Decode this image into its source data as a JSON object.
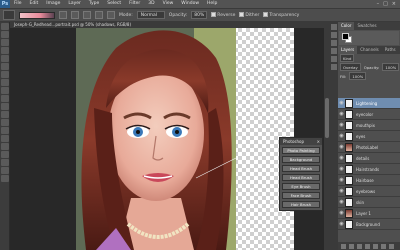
{
  "menubar": {
    "logo": "Ps",
    "items": [
      "File",
      "Edit",
      "Image",
      "Layer",
      "Type",
      "Select",
      "Filter",
      "3D",
      "View",
      "Window",
      "Help"
    ],
    "controls": [
      "–",
      "□",
      "×"
    ]
  },
  "options": {
    "mode_label": "Mode:",
    "mode_value": "Normal",
    "opacity_label": "Opacity:",
    "opacity_value": "80%",
    "reverse": "Reverse",
    "dither": "Dither",
    "transparency": "Transparency"
  },
  "document": {
    "tab_title": "Joseph-G_Redhead...portrait.psd @ 50% (shadows, RGB/8)"
  },
  "actions_panel": {
    "title": "Photoshop",
    "close": "×",
    "buttons": [
      "Photo Painting",
      "Background",
      "Head Brush",
      "Head Brush",
      "Eye Brush",
      "Face Brush",
      "Hair Brush"
    ]
  },
  "right_panel": {
    "top_tabs": [
      "Color",
      "Swatches"
    ],
    "mid_tabs": [
      "Layers",
      "Channels",
      "Paths"
    ],
    "kind_label": "Kind",
    "blend_mode": "Overlay",
    "opacity_label": "Opacity:",
    "opacity_value": "100%",
    "fill_label": "Fill:",
    "fill_value": "100%",
    "layers": [
      {
        "name": "Lightening",
        "selected": true,
        "thumb": "white"
      },
      {
        "name": "eyecolor",
        "selected": false,
        "thumb": "white"
      },
      {
        "name": "mouthpix",
        "selected": false,
        "thumb": "white"
      },
      {
        "name": "eyes",
        "selected": false,
        "thumb": "white"
      },
      {
        "name": "PhotoLabel",
        "selected": false,
        "thumb": "photo"
      },
      {
        "name": "details",
        "selected": false,
        "thumb": "white"
      },
      {
        "name": "Hairstrands",
        "selected": false,
        "thumb": "white"
      },
      {
        "name": "Hairbase",
        "selected": false,
        "thumb": "white"
      },
      {
        "name": "eyebrows",
        "selected": false,
        "thumb": "white"
      },
      {
        "name": "skin",
        "selected": false,
        "thumb": "white"
      },
      {
        "name": "Layer 1",
        "selected": false,
        "thumb": "photo"
      },
      {
        "name": "Background",
        "selected": false,
        "thumb": "white"
      }
    ]
  }
}
